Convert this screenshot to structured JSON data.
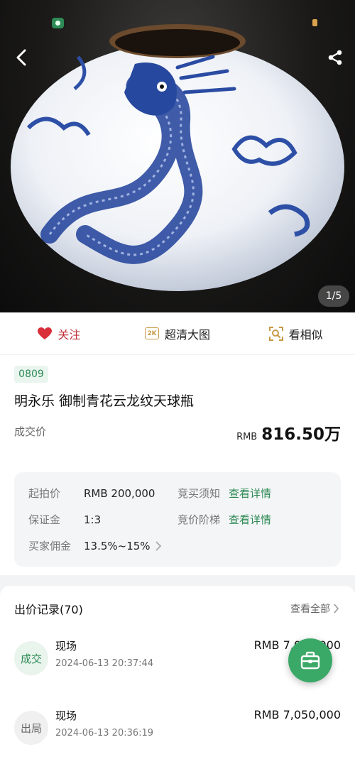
{
  "hero": {
    "page_indicator": "1/5",
    "icons": {
      "back": "chevron-left-icon",
      "share": "share-icon"
    }
  },
  "actions": [
    {
      "label": "关注",
      "icon": "heart-icon",
      "color": "#c0303a"
    },
    {
      "label": "超清大图",
      "icon": "2k-icon",
      "badge": "2K"
    },
    {
      "label": "看相似",
      "icon": "scan-similar-icon"
    }
  ],
  "lot": {
    "number": "0809",
    "title": "明永乐 御制青花云龙纹天球瓶",
    "price_label": "成交价",
    "price_currency": "RMB",
    "price_value": "816.50万"
  },
  "details": {
    "start_price_label": "起拍价",
    "start_price_value": "RMB 200,000",
    "deposit_label": "保证金",
    "deposit_value": "1:3",
    "commission_label": "买家佣金",
    "commission_value": "13.5%~15%",
    "notice_label": "竞买须知",
    "notice_link": "查看详情",
    "ladder_label": "竞价阶梯",
    "ladder_link": "查看详情"
  },
  "bids": {
    "title": "出价记录(70)",
    "view_all": "查看全部",
    "rows": [
      {
        "status": "成交",
        "name": "现场",
        "time": "2024-06-13 20:37:44",
        "amount": "RMB 7,050,000"
      },
      {
        "status": "出局",
        "name": "现场",
        "time": "2024-06-13 20:36:19",
        "amount": "RMB 7,050,000"
      }
    ]
  },
  "colors": {
    "accent_green": "#2e8a55",
    "fab_green": "#3aa867",
    "follow_red": "#c0303a",
    "gold": "#c79a45"
  }
}
